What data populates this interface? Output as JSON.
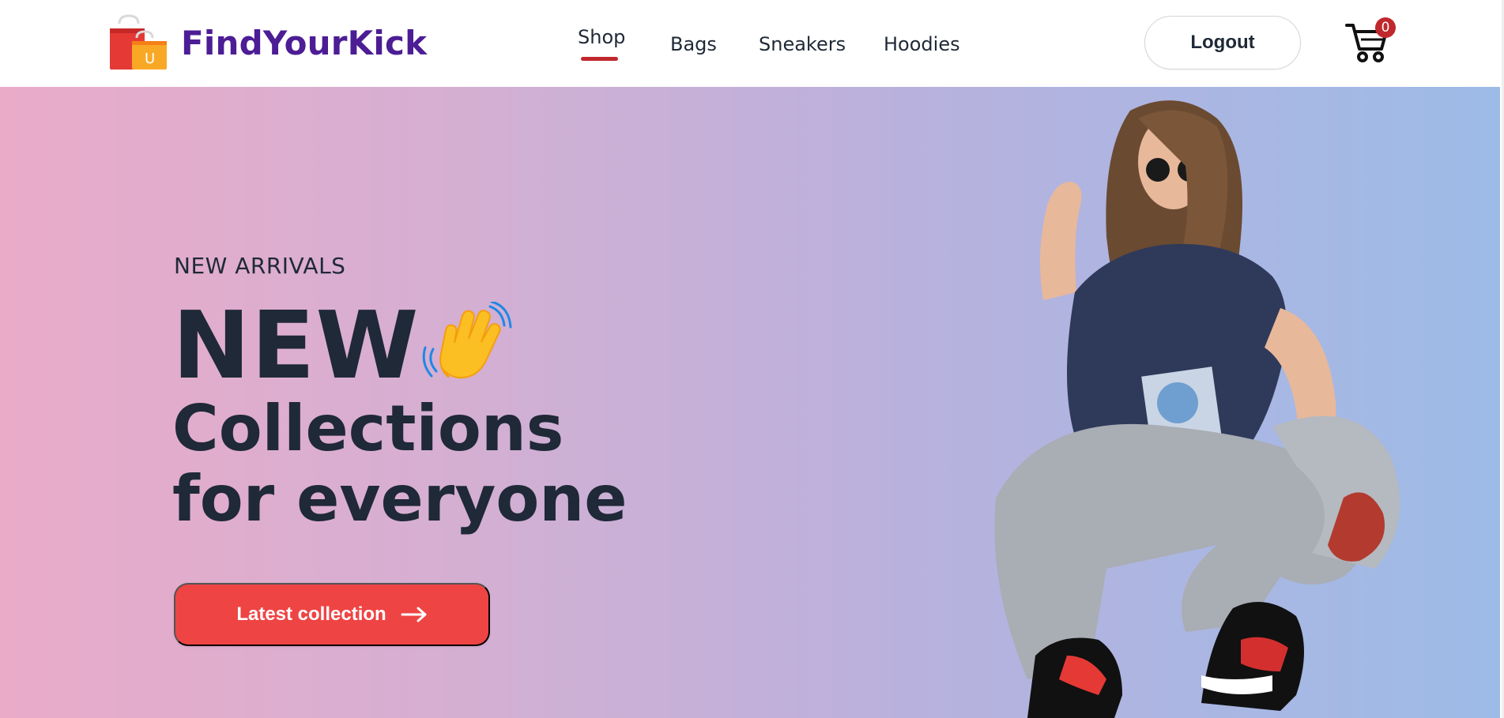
{
  "header": {
    "brand": "FindYourKick",
    "nav": [
      {
        "label": "Shop",
        "active": true
      },
      {
        "label": "Bags"
      },
      {
        "label": "Sneakers"
      },
      {
        "label": "Hoodies"
      }
    ],
    "logout_label": "Logout",
    "cart": {
      "count": "0",
      "icon": "cart-icon"
    }
  },
  "hero": {
    "eyebrow": "NEW ARRIVALS",
    "headline_line1": "NEW",
    "headline_line2": "Collections",
    "headline_line3": "for everyone",
    "cta_label": "Latest collection",
    "cta_icon": "arrow-right-icon",
    "wave_icon": "waving-hand-icon",
    "image": "fashion-model-image"
  },
  "colors": {
    "brand": "#4c1d95",
    "accent_red": "#ef4444",
    "active_underline": "#c0282d",
    "gradient_start": "#eaabc9",
    "gradient_end": "#9dbbe7"
  }
}
